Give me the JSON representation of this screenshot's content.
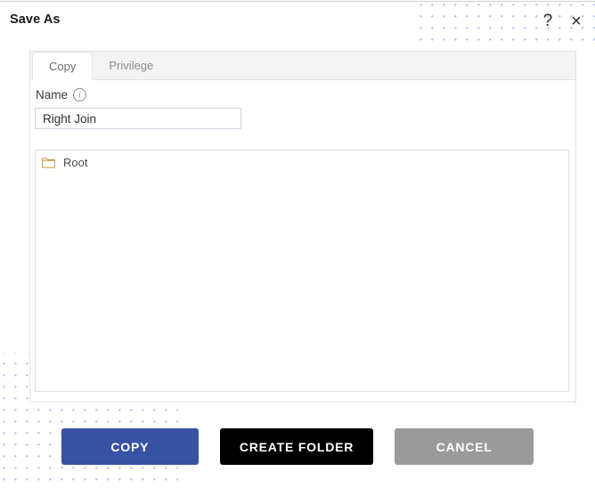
{
  "window": {
    "title": "Save As",
    "help_icon": "question-mark-icon",
    "help_label": "?",
    "close_icon": "close-icon",
    "close_label": "×"
  },
  "tabs": [
    {
      "label": "Copy",
      "active": true
    },
    {
      "label": "Privilege",
      "active": false
    }
  ],
  "form": {
    "name_label": "Name",
    "info_icon": "info-icon",
    "info_glyph": "i",
    "name_value": "Right Join",
    "name_placeholder": "Name"
  },
  "tree": {
    "items": [
      {
        "label": "Root",
        "icon": "folder-icon"
      }
    ]
  },
  "buttons": {
    "copy": "COPY",
    "create_folder": "CREATE FOLDER",
    "cancel": "CANCEL"
  },
  "colors": {
    "copy_bg": "#3852a4",
    "create_folder_bg": "#000000",
    "cancel_bg": "#9a9a9a",
    "dot_pattern": "#b9bfe8",
    "tabstrip_bg": "#f3f3f3",
    "border": "#e3e3e3"
  }
}
